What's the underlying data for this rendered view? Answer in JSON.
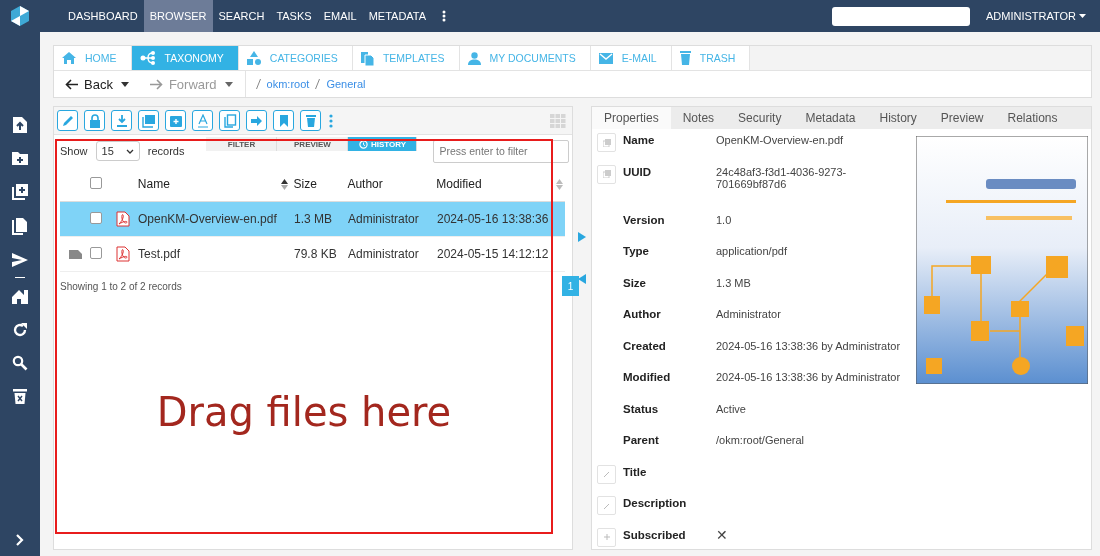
{
  "top_nav": {
    "items": [
      {
        "label": "DASHBOARD",
        "selected": false
      },
      {
        "label": "BROWSER",
        "selected": true
      },
      {
        "label": "SEARCH",
        "selected": false
      },
      {
        "label": "TASKS",
        "selected": false
      },
      {
        "label": "EMAIL",
        "selected": false
      },
      {
        "label": "METADATA",
        "selected": false
      }
    ],
    "user": "ADMINISTRATOR"
  },
  "nav_tabs": [
    {
      "label": "HOME",
      "kind": "home",
      "selected": false
    },
    {
      "label": "TAXONOMY",
      "kind": "taxonomy",
      "selected": true
    },
    {
      "label": "CATEGORIES",
      "kind": "categories",
      "selected": false
    },
    {
      "label": "TEMPLATES",
      "kind": "templates",
      "selected": false
    },
    {
      "label": "MY DOCUMENTS",
      "kind": "user",
      "selected": false
    },
    {
      "label": "E-MAIL",
      "kind": "mail",
      "selected": false
    },
    {
      "label": "TRASH",
      "kind": "trash",
      "selected": false
    }
  ],
  "history": {
    "back": "Back",
    "forward": "Forward",
    "forward_disabled": true,
    "breadcrumb": [
      "okm:root",
      "General"
    ]
  },
  "file_list": {
    "view_tabs": [
      {
        "label": "FILTER",
        "selected": false
      },
      {
        "label": "PREVIEW",
        "selected": false
      },
      {
        "label": "HISTORY",
        "selected": true
      }
    ],
    "show_label": "Show",
    "page_size": "15",
    "records_label": "records",
    "filter": {
      "placeholder": "Press enter to filter"
    },
    "all_checked": false,
    "columns": [
      "Name",
      "Size",
      "Author",
      "Modified"
    ],
    "rows": [
      {
        "name": "OpenKM-Overview-en.pdf",
        "size": "1.3 MB",
        "author": "Administrator",
        "modified": "2024-05-16 13:38:36",
        "selected": true,
        "checked": false,
        "has_note": false
      },
      {
        "name": "Test.pdf",
        "size": "79.8 KB",
        "author": "Administrator",
        "modified": "2024-05-15 14:12:12",
        "selected": false,
        "checked": false,
        "has_note": true
      }
    ],
    "summary": "Showing 1 to 2 of 2 records",
    "pages": [
      {
        "label": "1",
        "selected": true
      }
    ]
  },
  "drop_zone": "Drag files here",
  "properties": {
    "tabs": [
      {
        "label": "Properties",
        "selected": true
      },
      {
        "label": "Notes",
        "selected": false
      },
      {
        "label": "Security",
        "selected": false
      },
      {
        "label": "Metadata",
        "selected": false
      },
      {
        "label": "History",
        "selected": false
      },
      {
        "label": "Preview",
        "selected": false
      },
      {
        "label": "Relations",
        "selected": false
      }
    ],
    "fields": [
      {
        "label": "Name",
        "value": "OpenKM-Overview-en.pdf",
        "kind": "copy"
      },
      {
        "label": "UUID",
        "value": "24c48af3-f3d1-4036-9273-701669bf87d6",
        "kind": "copy"
      },
      {
        "label": "Version",
        "value": "1.0",
        "kind": "plain"
      },
      {
        "label": "Type",
        "value": "application/pdf",
        "kind": "plain"
      },
      {
        "label": "Size",
        "value": "1.3 MB",
        "kind": "plain"
      },
      {
        "label": "Author",
        "value": "Administrator",
        "kind": "plain"
      },
      {
        "label": "Created",
        "value": "2024-05-16 13:38:36 by Administrator",
        "kind": "plain"
      },
      {
        "label": "Modified",
        "value": "2024-05-16 13:38:36 by Administrator",
        "kind": "plain"
      },
      {
        "label": "Status",
        "value": "Active",
        "kind": "plain"
      },
      {
        "label": "Parent",
        "value": "/okm:root/General",
        "kind": "plain"
      },
      {
        "label": "Title",
        "kind": "edit"
      },
      {
        "label": "Description",
        "kind": "edit"
      },
      {
        "label": "Subscribed",
        "value": "✕",
        "kind": "subscribe"
      }
    ]
  }
}
